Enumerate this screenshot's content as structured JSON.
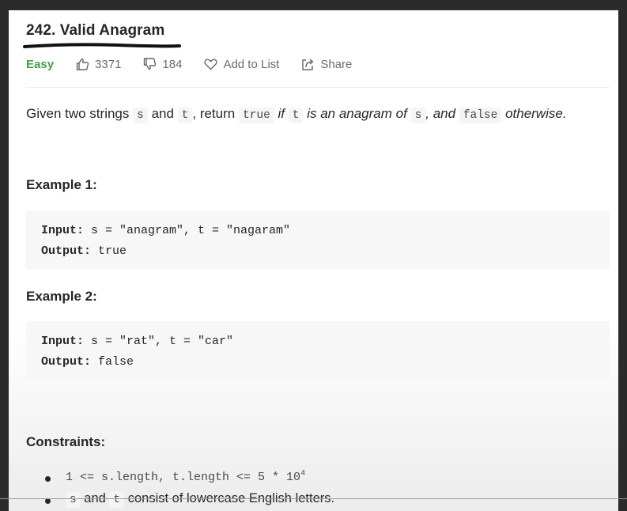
{
  "problem": {
    "title": "242. Valid Anagram",
    "difficulty": "Easy",
    "likes": "3371",
    "dislikes": "184",
    "add_to_list": "Add to List",
    "share": "Share"
  },
  "description": {
    "part1": "Given two strings",
    "s": "s",
    "and": "and",
    "t": "t",
    "comma_return": ", return",
    "true": "true",
    "if": "if",
    "is_anagram_of": "is an anagram of",
    "comma_and": ", and",
    "false": "false",
    "otherwise": "otherwise."
  },
  "examples": [
    {
      "heading": "Example 1:",
      "input_label": "Input:",
      "input_value": " s = \"anagram\", t = \"nagaram\"",
      "output_label": "Output:",
      "output_value": " true"
    },
    {
      "heading": "Example 2:",
      "input_label": "Input:",
      "input_value": " s = \"rat\", t = \"car\"",
      "output_label": "Output:",
      "output_value": " false"
    }
  ],
  "constraints": {
    "heading": "Constraints:",
    "item1_code": "1 <= s.length, t.length <= 5 * 10",
    "item1_sup": "4",
    "item2_s": "s",
    "item2_and": "and",
    "item2_t": "t",
    "item2_rest": "consist of lowercase English letters."
  },
  "colors": {
    "easy": "#43a047",
    "text": "#262626",
    "code_bg": "#f5f5f5"
  }
}
